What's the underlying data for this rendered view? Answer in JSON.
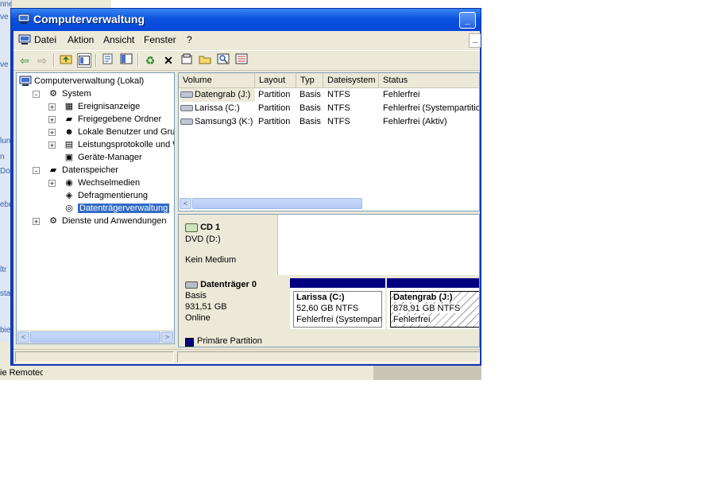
{
  "background": {
    "left_texts": [
      "nnen",
      "ve",
      "",
      "ve",
      "",
      "lun",
      "n",
      "Dok",
      "",
      "ebu",
      "",
      "ltr",
      "sta",
      "bie"
    ],
    "taskbar_text": "ie Remotec"
  },
  "window": {
    "title": "Computerverwaltung",
    "title_buttons": {
      "minimize": "_",
      "inner_minimize": "_"
    }
  },
  "menu": [
    "Datei",
    "Aktion",
    "Ansicht",
    "Fenster",
    "?"
  ],
  "toolbar": {
    "icons": [
      "back-icon",
      "forward-icon",
      "up-folder-icon",
      "show-hide-tree-icon",
      "properties-icon",
      "help-icon",
      "refresh-icon",
      "delete-icon",
      "properties-sheet-icon",
      "open-folder-icon",
      "search-icon",
      "settings-icon"
    ]
  },
  "tree": {
    "root": "Computerverwaltung (Lokal)",
    "items": [
      {
        "label": "System",
        "level": 1,
        "expander": "-"
      },
      {
        "label": "Ereignisanzeige",
        "level": 2,
        "expander": "+"
      },
      {
        "label": "Freigegebene Ordner",
        "level": 2,
        "expander": "+"
      },
      {
        "label": "Lokale Benutzer und Gruppe",
        "level": 2,
        "expander": "+"
      },
      {
        "label": "Leistungsprotokolle und War",
        "level": 2,
        "expander": "+"
      },
      {
        "label": "Geräte-Manager",
        "level": 2,
        "expander": ""
      },
      {
        "label": "Datenspeicher",
        "level": 1,
        "expander": "-"
      },
      {
        "label": "Wechselmedien",
        "level": 2,
        "expander": "+"
      },
      {
        "label": "Defragmentierung",
        "level": 2,
        "expander": ""
      },
      {
        "label": "Datenträgerverwaltung",
        "level": 2,
        "expander": "",
        "selected": true
      },
      {
        "label": "Dienste und Anwendungen",
        "level": 1,
        "expander": "+"
      }
    ]
  },
  "volumes": {
    "columns": [
      "Volume",
      "Layout",
      "Typ",
      "Dateisystem",
      "Status"
    ],
    "rows": [
      {
        "volume": "Datengrab (J:)",
        "layout": "Partition",
        "typ": "Basis",
        "fs": "NTFS",
        "status": "Fehlerfrei"
      },
      {
        "volume": "Larissa (C:)",
        "layout": "Partition",
        "typ": "Basis",
        "fs": "NTFS",
        "status": "Fehlerfrei (Systempartition)"
      },
      {
        "volume": "Samsung3 (K:)",
        "layout": "Partition",
        "typ": "Basis",
        "fs": "NTFS",
        "status": "Fehlerfrei (Aktiv)"
      }
    ]
  },
  "diskmap": {
    "cd": {
      "name": "CD 1",
      "type": "DVD (D:)",
      "media": "Kein Medium"
    },
    "disk0": {
      "name": "Datenträger 0",
      "type": "Basis",
      "size": "931,51 GB",
      "state": "Online"
    },
    "partitions": [
      {
        "name": "Larissa  (C:)",
        "size": "52,60 GB NTFS",
        "status": "Fehlerfrei (Systempartition)"
      },
      {
        "name": "Datengrab  (J:)",
        "size": "878,91 GB NTFS",
        "status": "Fehlerfrei"
      }
    ],
    "legend": "Primäre Partition",
    "legend_color": "#000080"
  },
  "scroll_arrows": {
    "left": "<",
    "right": ">"
  }
}
